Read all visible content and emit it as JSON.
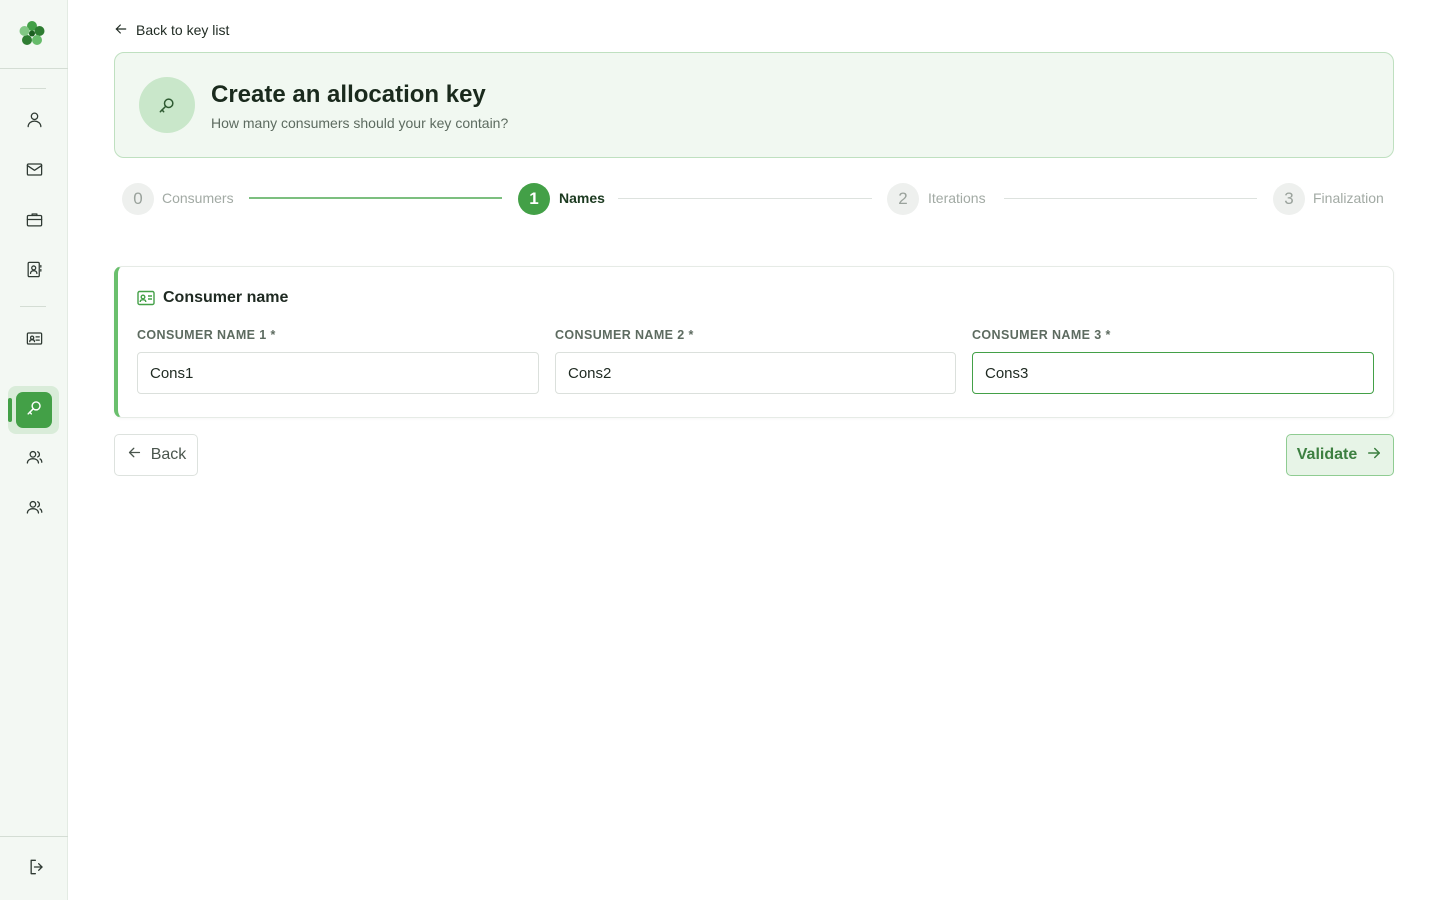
{
  "nav": {
    "back_to_list": "Back to key list",
    "items": [
      {
        "icon": "user-icon"
      },
      {
        "icon": "mail-icon"
      },
      {
        "icon": "briefcase-icon"
      },
      {
        "icon": "contact-book-icon"
      },
      {
        "icon": "id-card-icon"
      },
      {
        "icon": "key-icon",
        "active": true
      },
      {
        "icon": "users-icon"
      },
      {
        "icon": "users-icon"
      }
    ],
    "logout_icon": "logout-icon"
  },
  "header": {
    "title": "Create an allocation key",
    "subtitle": "How many consumers should your key contain?",
    "icon": "key-icon"
  },
  "stepper": {
    "steps": [
      {
        "number": "0",
        "label": "Consumers",
        "state": "done"
      },
      {
        "number": "1",
        "label": "Names",
        "state": "active"
      },
      {
        "number": "2",
        "label": "Iterations",
        "state": "pending"
      },
      {
        "number": "3",
        "label": "Finalization",
        "state": "pending"
      }
    ]
  },
  "form": {
    "title": "Consumer name",
    "fields": [
      {
        "label": "CONSUMER NAME 1 *",
        "value": "Cons1"
      },
      {
        "label": "CONSUMER NAME 2 *",
        "value": "Cons2"
      },
      {
        "label": "CONSUMER NAME 3 *",
        "value": "Cons3",
        "focused": true
      }
    ]
  },
  "actions": {
    "back_label": "Back",
    "validate_label": "Validate"
  },
  "colors": {
    "accent": "#43a047",
    "accent_light": "#e7f4e7",
    "sidebar_bg": "#f3f8f3"
  }
}
